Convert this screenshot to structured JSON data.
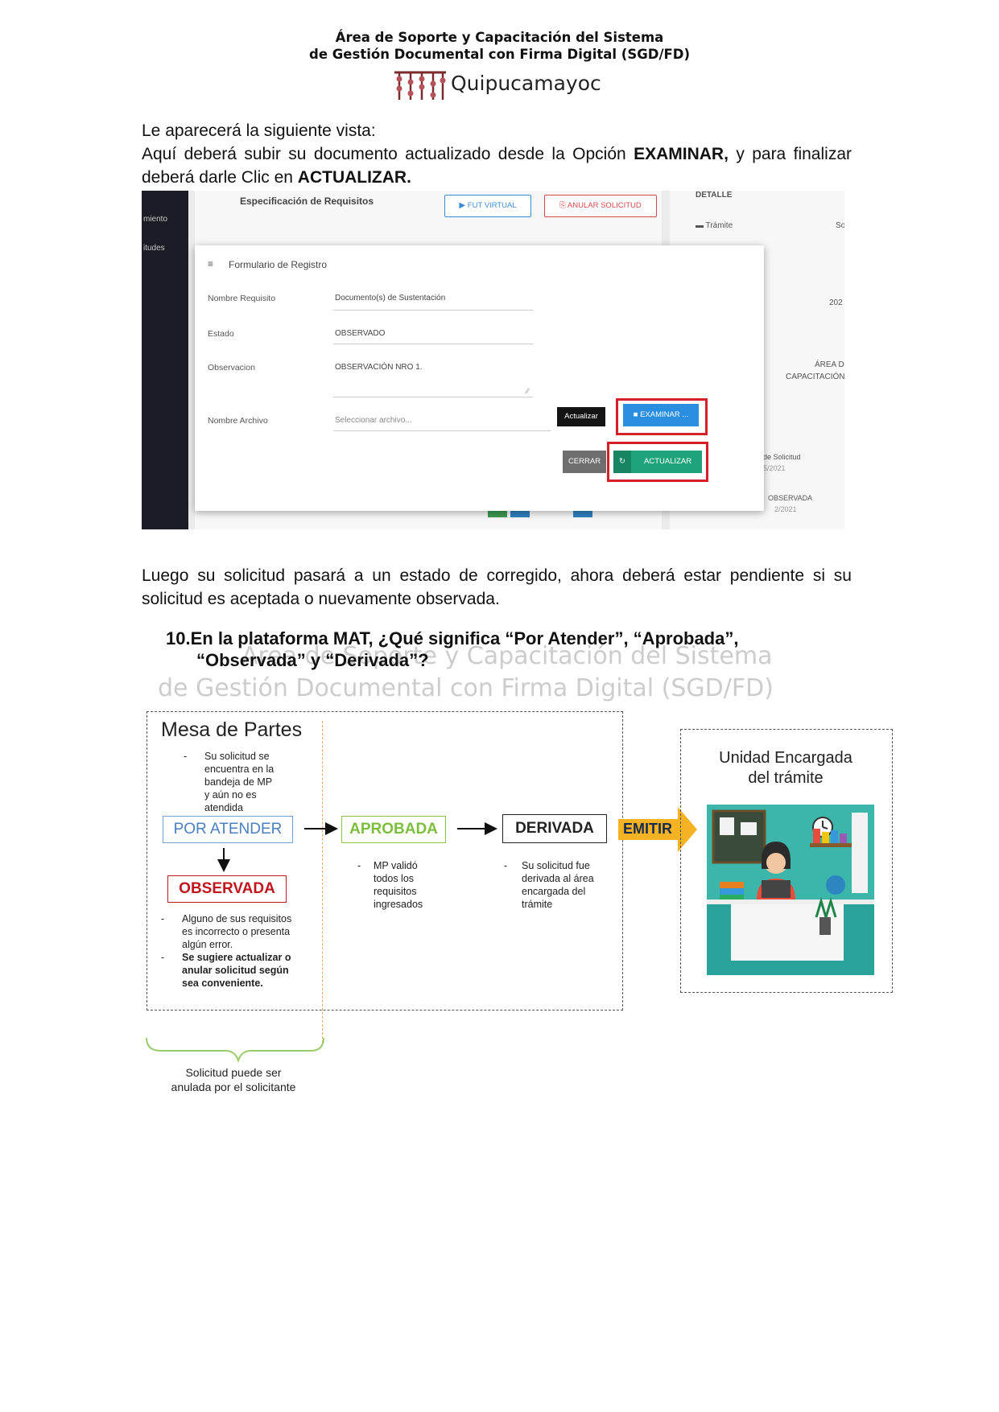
{
  "header": {
    "line1": "Área de Soporte y Capacitación del Sistema",
    "line2": "de Gestión Documental con Firma Digital (SGD/FD)",
    "logo_text": "Quipucamayoc"
  },
  "intro": {
    "line1": "Le aparecerá la siguiente vista:",
    "p2_a": "Aquí deberá subir su documento actualizado desde la Opción ",
    "p2_b": "EXAMINAR,",
    "p2_c": " y para finalizar deberá darle Clic en ",
    "p2_d": "ACTUALIZAR."
  },
  "screenshot": {
    "sidebar_items": [
      "miento",
      "itudes"
    ],
    "section_title": "Especificación de Requisitos",
    "fut_button": "FUT VIRTUAL",
    "anular_button": "ANULAR SOLICITUD",
    "right_detail": "DETALLE",
    "right_tramite": "Trámite",
    "right_so": "So",
    "right_202": "202",
    "right_area": "ÁREA D",
    "right_capac": "CAPACITACIÓN",
    "right_solicitud": "de Solicitud",
    "right_date1": "5/2021",
    "right_observada": "OBSERVADA",
    "right_date2": "2/2021",
    "modal": {
      "title": "Formulario de Registro",
      "label_nombre": "Nombre Requisito",
      "value_nombre": "Documento(s) de Sustentación",
      "label_estado": "Estado",
      "value_estado": "OBSERVADO",
      "label_obs": "Observacion",
      "value_obs": "OBSERVACIÓN NRO 1.",
      "label_archivo": "Nombre Archivo",
      "placeholder_archivo": "Seleccionar archivo...",
      "btn_actualizar_small": "Actualizar",
      "btn_examinar": "EXAMINAR ...",
      "btn_cerrar": "CERRAR",
      "btn_actualizar": "ACTUALIZAR"
    }
  },
  "after": {
    "text": "Luego su solicitud pasará a un estado de corregido, ahora deberá estar pendiente si su solicitud es aceptada o nuevamente observada."
  },
  "question": {
    "number": "10.",
    "line1": "En la plataforma MAT, ¿Qué significa “Por Atender”, “Aprobada”,",
    "line2": "“Observada” y “Derivada”?"
  },
  "watermark": {
    "line1": "Área de Soporte y Capacitación del Sistema",
    "line2": "de Gestión Documental con Firma Digital (SGD/FD)"
  },
  "diagram": {
    "mesa_title": "Mesa de Partes",
    "mesa_desc": [
      "Su solicitud se",
      "encuentra en la",
      "bandeja de MP",
      "y aún no es",
      "atendida"
    ],
    "por_atender": "POR ATENDER",
    "aprobada": "APROBADA",
    "derivada": "DERIVADA",
    "emitir": "EMITIR",
    "observada": "OBSERVADA",
    "aprobada_desc": [
      "MP validó",
      "todos los",
      "requisitos",
      "ingresados"
    ],
    "derivada_desc": [
      "Su solicitud fue",
      "derivada al área",
      "encargada del",
      "trámite"
    ],
    "observada_desc1": [
      "Alguno de sus requisitos",
      "es incorrecto o presenta",
      "algún error."
    ],
    "observada_desc2": [
      "Se sugiere actualizar o",
      "anular solicitud según",
      "sea conveniente."
    ],
    "unidad_title_1": "Unidad Encargada",
    "unidad_title_2": "del trámite",
    "brace_label_1": "Solicitud puede ser",
    "brace_label_2": "anulada por el solicitante",
    "colors": {
      "por_atender": "#6fa0d8",
      "aprobada": "#8cc63f",
      "observada": "#c0161d",
      "emitir": "#f5b323",
      "brace": "#9acd6a",
      "orange_dash": "#f2a65a"
    }
  }
}
